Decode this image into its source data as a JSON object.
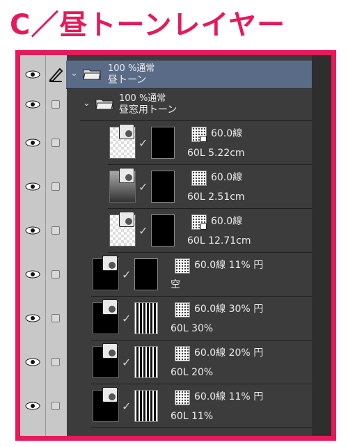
{
  "heading": "C／昼トーンレイヤー",
  "colors": {
    "accent": "#e6195a",
    "panel": "#3c3c3c",
    "selected": "#5a6b88"
  },
  "layers": [
    {
      "line1": "100 %通常",
      "line2": "昼トーン",
      "kind": "folder",
      "selected": true
    },
    {
      "line1": "100 %通常",
      "line2": "昼窓用トーン",
      "kind": "folder",
      "selected": false
    },
    {
      "tone": "60.0線",
      "info": "60L 5.22cm",
      "kind": "tone"
    },
    {
      "tone": "60.0線",
      "info": "60L 2.51cm",
      "kind": "tone"
    },
    {
      "tone": "60.0線",
      "info": "60L 12.71cm",
      "kind": "tone"
    },
    {
      "tone": "60.0線 11% 円",
      "info": "空",
      "kind": "tone"
    },
    {
      "tone": "60.0線 30% 円",
      "info": "60L 30%",
      "kind": "tone"
    },
    {
      "tone": "60.0線 20% 円",
      "info": "60L 20%",
      "kind": "tone"
    },
    {
      "tone": "60.0線 11% 円",
      "info": "60L 11%",
      "kind": "tone"
    }
  ],
  "icons": [
    "eye-icon",
    "pencil-icon",
    "folder-icon",
    "chevron-down-icon",
    "checkbox-icon",
    "tone-icon"
  ]
}
